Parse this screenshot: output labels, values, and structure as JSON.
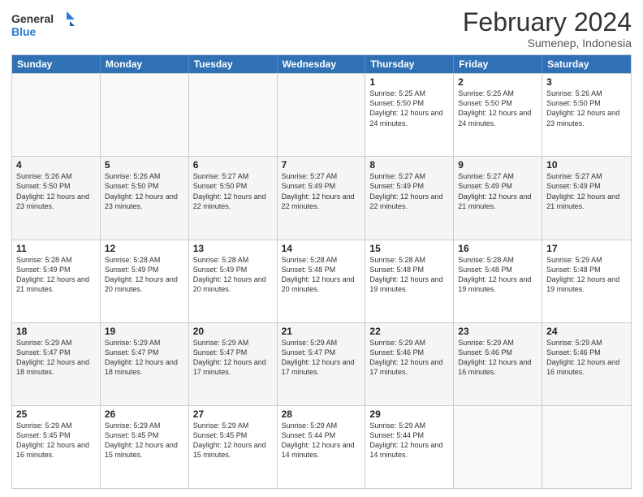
{
  "header": {
    "logo_general": "General",
    "logo_blue": "Blue",
    "title": "February 2024",
    "subtitle": "Sumenep, Indonesia"
  },
  "days": [
    "Sunday",
    "Monday",
    "Tuesday",
    "Wednesday",
    "Thursday",
    "Friday",
    "Saturday"
  ],
  "weeks": [
    [
      {
        "day": "",
        "sunrise": "",
        "sunset": "",
        "daylight": "",
        "empty": true
      },
      {
        "day": "",
        "sunrise": "",
        "sunset": "",
        "daylight": "",
        "empty": true
      },
      {
        "day": "",
        "sunrise": "",
        "sunset": "",
        "daylight": "",
        "empty": true
      },
      {
        "day": "",
        "sunrise": "",
        "sunset": "",
        "daylight": "",
        "empty": true
      },
      {
        "day": "1",
        "sunrise": "Sunrise: 5:25 AM",
        "sunset": "Sunset: 5:50 PM",
        "daylight": "Daylight: 12 hours and 24 minutes.",
        "empty": false
      },
      {
        "day": "2",
        "sunrise": "Sunrise: 5:25 AM",
        "sunset": "Sunset: 5:50 PM",
        "daylight": "Daylight: 12 hours and 24 minutes.",
        "empty": false
      },
      {
        "day": "3",
        "sunrise": "Sunrise: 5:26 AM",
        "sunset": "Sunset: 5:50 PM",
        "daylight": "Daylight: 12 hours and 23 minutes.",
        "empty": false
      }
    ],
    [
      {
        "day": "4",
        "sunrise": "Sunrise: 5:26 AM",
        "sunset": "Sunset: 5:50 PM",
        "daylight": "Daylight: 12 hours and 23 minutes.",
        "empty": false
      },
      {
        "day": "5",
        "sunrise": "Sunrise: 5:26 AM",
        "sunset": "Sunset: 5:50 PM",
        "daylight": "Daylight: 12 hours and 23 minutes.",
        "empty": false
      },
      {
        "day": "6",
        "sunrise": "Sunrise: 5:27 AM",
        "sunset": "Sunset: 5:50 PM",
        "daylight": "Daylight: 12 hours and 22 minutes.",
        "empty": false
      },
      {
        "day": "7",
        "sunrise": "Sunrise: 5:27 AM",
        "sunset": "Sunset: 5:49 PM",
        "daylight": "Daylight: 12 hours and 22 minutes.",
        "empty": false
      },
      {
        "day": "8",
        "sunrise": "Sunrise: 5:27 AM",
        "sunset": "Sunset: 5:49 PM",
        "daylight": "Daylight: 12 hours and 22 minutes.",
        "empty": false
      },
      {
        "day": "9",
        "sunrise": "Sunrise: 5:27 AM",
        "sunset": "Sunset: 5:49 PM",
        "daylight": "Daylight: 12 hours and 21 minutes.",
        "empty": false
      },
      {
        "day": "10",
        "sunrise": "Sunrise: 5:27 AM",
        "sunset": "Sunset: 5:49 PM",
        "daylight": "Daylight: 12 hours and 21 minutes.",
        "empty": false
      }
    ],
    [
      {
        "day": "11",
        "sunrise": "Sunrise: 5:28 AM",
        "sunset": "Sunset: 5:49 PM",
        "daylight": "Daylight: 12 hours and 21 minutes.",
        "empty": false
      },
      {
        "day": "12",
        "sunrise": "Sunrise: 5:28 AM",
        "sunset": "Sunset: 5:49 PM",
        "daylight": "Daylight: 12 hours and 20 minutes.",
        "empty": false
      },
      {
        "day": "13",
        "sunrise": "Sunrise: 5:28 AM",
        "sunset": "Sunset: 5:49 PM",
        "daylight": "Daylight: 12 hours and 20 minutes.",
        "empty": false
      },
      {
        "day": "14",
        "sunrise": "Sunrise: 5:28 AM",
        "sunset": "Sunset: 5:48 PM",
        "daylight": "Daylight: 12 hours and 20 minutes.",
        "empty": false
      },
      {
        "day": "15",
        "sunrise": "Sunrise: 5:28 AM",
        "sunset": "Sunset: 5:48 PM",
        "daylight": "Daylight: 12 hours and 19 minutes.",
        "empty": false
      },
      {
        "day": "16",
        "sunrise": "Sunrise: 5:28 AM",
        "sunset": "Sunset: 5:48 PM",
        "daylight": "Daylight: 12 hours and 19 minutes.",
        "empty": false
      },
      {
        "day": "17",
        "sunrise": "Sunrise: 5:29 AM",
        "sunset": "Sunset: 5:48 PM",
        "daylight": "Daylight: 12 hours and 19 minutes.",
        "empty": false
      }
    ],
    [
      {
        "day": "18",
        "sunrise": "Sunrise: 5:29 AM",
        "sunset": "Sunset: 5:47 PM",
        "daylight": "Daylight: 12 hours and 18 minutes.",
        "empty": false
      },
      {
        "day": "19",
        "sunrise": "Sunrise: 5:29 AM",
        "sunset": "Sunset: 5:47 PM",
        "daylight": "Daylight: 12 hours and 18 minutes.",
        "empty": false
      },
      {
        "day": "20",
        "sunrise": "Sunrise: 5:29 AM",
        "sunset": "Sunset: 5:47 PM",
        "daylight": "Daylight: 12 hours and 17 minutes.",
        "empty": false
      },
      {
        "day": "21",
        "sunrise": "Sunrise: 5:29 AM",
        "sunset": "Sunset: 5:47 PM",
        "daylight": "Daylight: 12 hours and 17 minutes.",
        "empty": false
      },
      {
        "day": "22",
        "sunrise": "Sunrise: 5:29 AM",
        "sunset": "Sunset: 5:46 PM",
        "daylight": "Daylight: 12 hours and 17 minutes.",
        "empty": false
      },
      {
        "day": "23",
        "sunrise": "Sunrise: 5:29 AM",
        "sunset": "Sunset: 5:46 PM",
        "daylight": "Daylight: 12 hours and 16 minutes.",
        "empty": false
      },
      {
        "day": "24",
        "sunrise": "Sunrise: 5:29 AM",
        "sunset": "Sunset: 5:46 PM",
        "daylight": "Daylight: 12 hours and 16 minutes.",
        "empty": false
      }
    ],
    [
      {
        "day": "25",
        "sunrise": "Sunrise: 5:29 AM",
        "sunset": "Sunset: 5:45 PM",
        "daylight": "Daylight: 12 hours and 16 minutes.",
        "empty": false
      },
      {
        "day": "26",
        "sunrise": "Sunrise: 5:29 AM",
        "sunset": "Sunset: 5:45 PM",
        "daylight": "Daylight: 12 hours and 15 minutes.",
        "empty": false
      },
      {
        "day": "27",
        "sunrise": "Sunrise: 5:29 AM",
        "sunset": "Sunset: 5:45 PM",
        "daylight": "Daylight: 12 hours and 15 minutes.",
        "empty": false
      },
      {
        "day": "28",
        "sunrise": "Sunrise: 5:29 AM",
        "sunset": "Sunset: 5:44 PM",
        "daylight": "Daylight: 12 hours and 14 minutes.",
        "empty": false
      },
      {
        "day": "29",
        "sunrise": "Sunrise: 5:29 AM",
        "sunset": "Sunset: 5:44 PM",
        "daylight": "Daylight: 12 hours and 14 minutes.",
        "empty": false
      },
      {
        "day": "",
        "sunrise": "",
        "sunset": "",
        "daylight": "",
        "empty": true
      },
      {
        "day": "",
        "sunrise": "",
        "sunset": "",
        "daylight": "",
        "empty": true
      }
    ]
  ]
}
